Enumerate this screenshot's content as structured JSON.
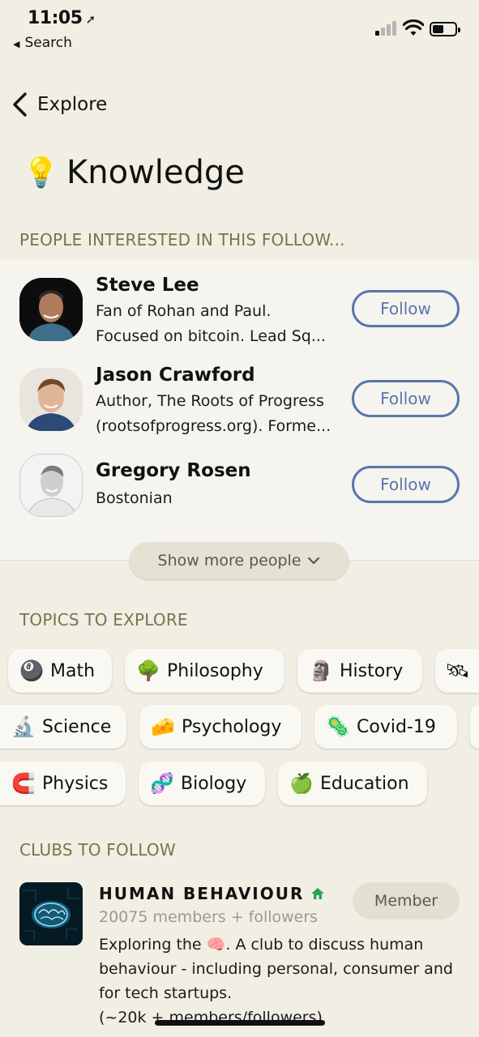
{
  "status_bar": {
    "time": "11:05",
    "back_app": "Search"
  },
  "nav": {
    "back_label": "Explore"
  },
  "header": {
    "emoji": "💡",
    "title": "Knowledge"
  },
  "people_section": {
    "heading": "PEOPLE INTERESTED IN THIS FOLLOW...",
    "people": [
      {
        "name": "Steve Lee",
        "bio_line1": "Fan of Rohan and Paul.",
        "bio_line2": "Focused on bitcoin. Lead Sq...",
        "button": "Follow"
      },
      {
        "name": "Jason Crawford",
        "bio_line1": "Author, The Roots of Progress",
        "bio_line2": "(rootsofprogress.org). Forme...",
        "button": "Follow"
      },
      {
        "name": "Gregory Rosen",
        "bio_line1": "Bostonian",
        "bio_line2": "",
        "button": "Follow"
      }
    ],
    "show_more": "Show more people"
  },
  "topics_section": {
    "heading": "TOPICS TO EXPLORE",
    "topics": [
      {
        "emoji": "🎱",
        "label": "Math"
      },
      {
        "emoji": "🌳",
        "label": "Philosophy"
      },
      {
        "emoji": "🗿",
        "label": "History"
      },
      {
        "emoji": "🛰",
        "label": ""
      },
      {
        "emoji": "🔬",
        "label": "Science"
      },
      {
        "emoji": "🧀",
        "label": "Psychology"
      },
      {
        "emoji": "🦠",
        "label": "Covid-19"
      },
      {
        "emoji": "🧲",
        "label": "Physics"
      },
      {
        "emoji": "🧬",
        "label": "Biology"
      },
      {
        "emoji": "🍏",
        "label": "Education"
      }
    ]
  },
  "clubs_section": {
    "heading": "CLUBS TO FOLLOW",
    "club": {
      "name": "HUMAN BEHAVIOUR",
      "meta": "20075 members + followers",
      "desc_pre": "Exploring the",
      "desc_emoji": "🧠",
      "desc_post": ". A club to discuss human behaviour -  including personal, consumer and for tech startups.",
      "desc_line4": "(~20k + members/followers)",
      "button": "Member"
    }
  },
  "colors": {
    "background": "#f1efe4",
    "accent_blue": "#5a76ad",
    "section_heading": "#7a7349",
    "club_house_green": "#27a55a"
  }
}
